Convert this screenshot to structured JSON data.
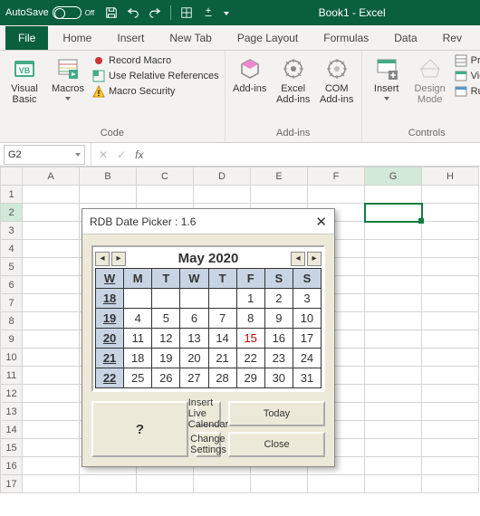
{
  "titlebar": {
    "autosave_label": "AutoSave",
    "autosave_state": "Off",
    "app_title": "Book1 - Excel"
  },
  "tabs": {
    "file": "File",
    "home": "Home",
    "insert": "Insert",
    "newtab": "New Tab",
    "pagelayout": "Page Layout",
    "formulas": "Formulas",
    "data": "Data",
    "review": "Rev"
  },
  "ribbon": {
    "code": {
      "visual_basic": "Visual Basic",
      "macros": "Macros",
      "record_macro": "Record Macro",
      "use_rel_refs": "Use Relative References",
      "macro_security": "Macro Security",
      "group_label": "Code"
    },
    "addins": {
      "addins": "Add-ins",
      "excel_addins": "Excel Add-ins",
      "com_addins": "COM Add-ins",
      "group_label": "Add-ins"
    },
    "controls": {
      "insert": "Insert",
      "design_mode": "Design Mode",
      "properties": "Pro",
      "view_code": "Vie",
      "run_dialog": "Ru",
      "group_label": "Controls"
    }
  },
  "formula_bar": {
    "namebox_value": "G2",
    "fx": "fx"
  },
  "sheet": {
    "cols": [
      "A",
      "B",
      "C",
      "D",
      "E",
      "F",
      "G",
      "H"
    ],
    "rows": [
      "1",
      "2",
      "3",
      "4",
      "5",
      "6",
      "7",
      "8",
      "9",
      "10",
      "11",
      "12",
      "13",
      "14",
      "15",
      "16",
      "17"
    ],
    "selected_col": "G",
    "selected_row": "2"
  },
  "dialog": {
    "title": "RDB Date Picker : 1.6",
    "month_label": "May 2020",
    "dow": [
      "W",
      "M",
      "T",
      "W",
      "T",
      "F",
      "S",
      "S"
    ],
    "weeks": [
      {
        "wk": "18",
        "days": [
          "",
          "",
          "",
          "",
          "1",
          "2",
          "3"
        ]
      },
      {
        "wk": "19",
        "days": [
          "4",
          "5",
          "6",
          "7",
          "8",
          "9",
          "10"
        ]
      },
      {
        "wk": "20",
        "days": [
          "11",
          "12",
          "13",
          "14",
          "15",
          "16",
          "17"
        ]
      },
      {
        "wk": "21",
        "days": [
          "18",
          "19",
          "20",
          "21",
          "22",
          "23",
          "24"
        ]
      },
      {
        "wk": "22",
        "days": [
          "25",
          "26",
          "27",
          "28",
          "29",
          "30",
          "31"
        ]
      }
    ],
    "today_value": "15",
    "btn_insert": "Insert Live Calendar",
    "btn_change": "Change Settings",
    "btn_help": "?",
    "btn_today": "Today",
    "btn_close": "Close"
  },
  "chart_data": {
    "type": "table",
    "title": "May 2020",
    "columns": [
      "Week",
      "Mon",
      "Tue",
      "Wed",
      "Thu",
      "Fri",
      "Sat",
      "Sun"
    ],
    "rows": [
      [
        18,
        null,
        null,
        null,
        null,
        1,
        2,
        3
      ],
      [
        19,
        4,
        5,
        6,
        7,
        8,
        9,
        10
      ],
      [
        20,
        11,
        12,
        13,
        14,
        15,
        16,
        17
      ],
      [
        21,
        18,
        19,
        20,
        21,
        22,
        23,
        24
      ],
      [
        22,
        25,
        26,
        27,
        28,
        29,
        30,
        31
      ]
    ],
    "highlight": {
      "label": "today",
      "value": 15
    }
  }
}
